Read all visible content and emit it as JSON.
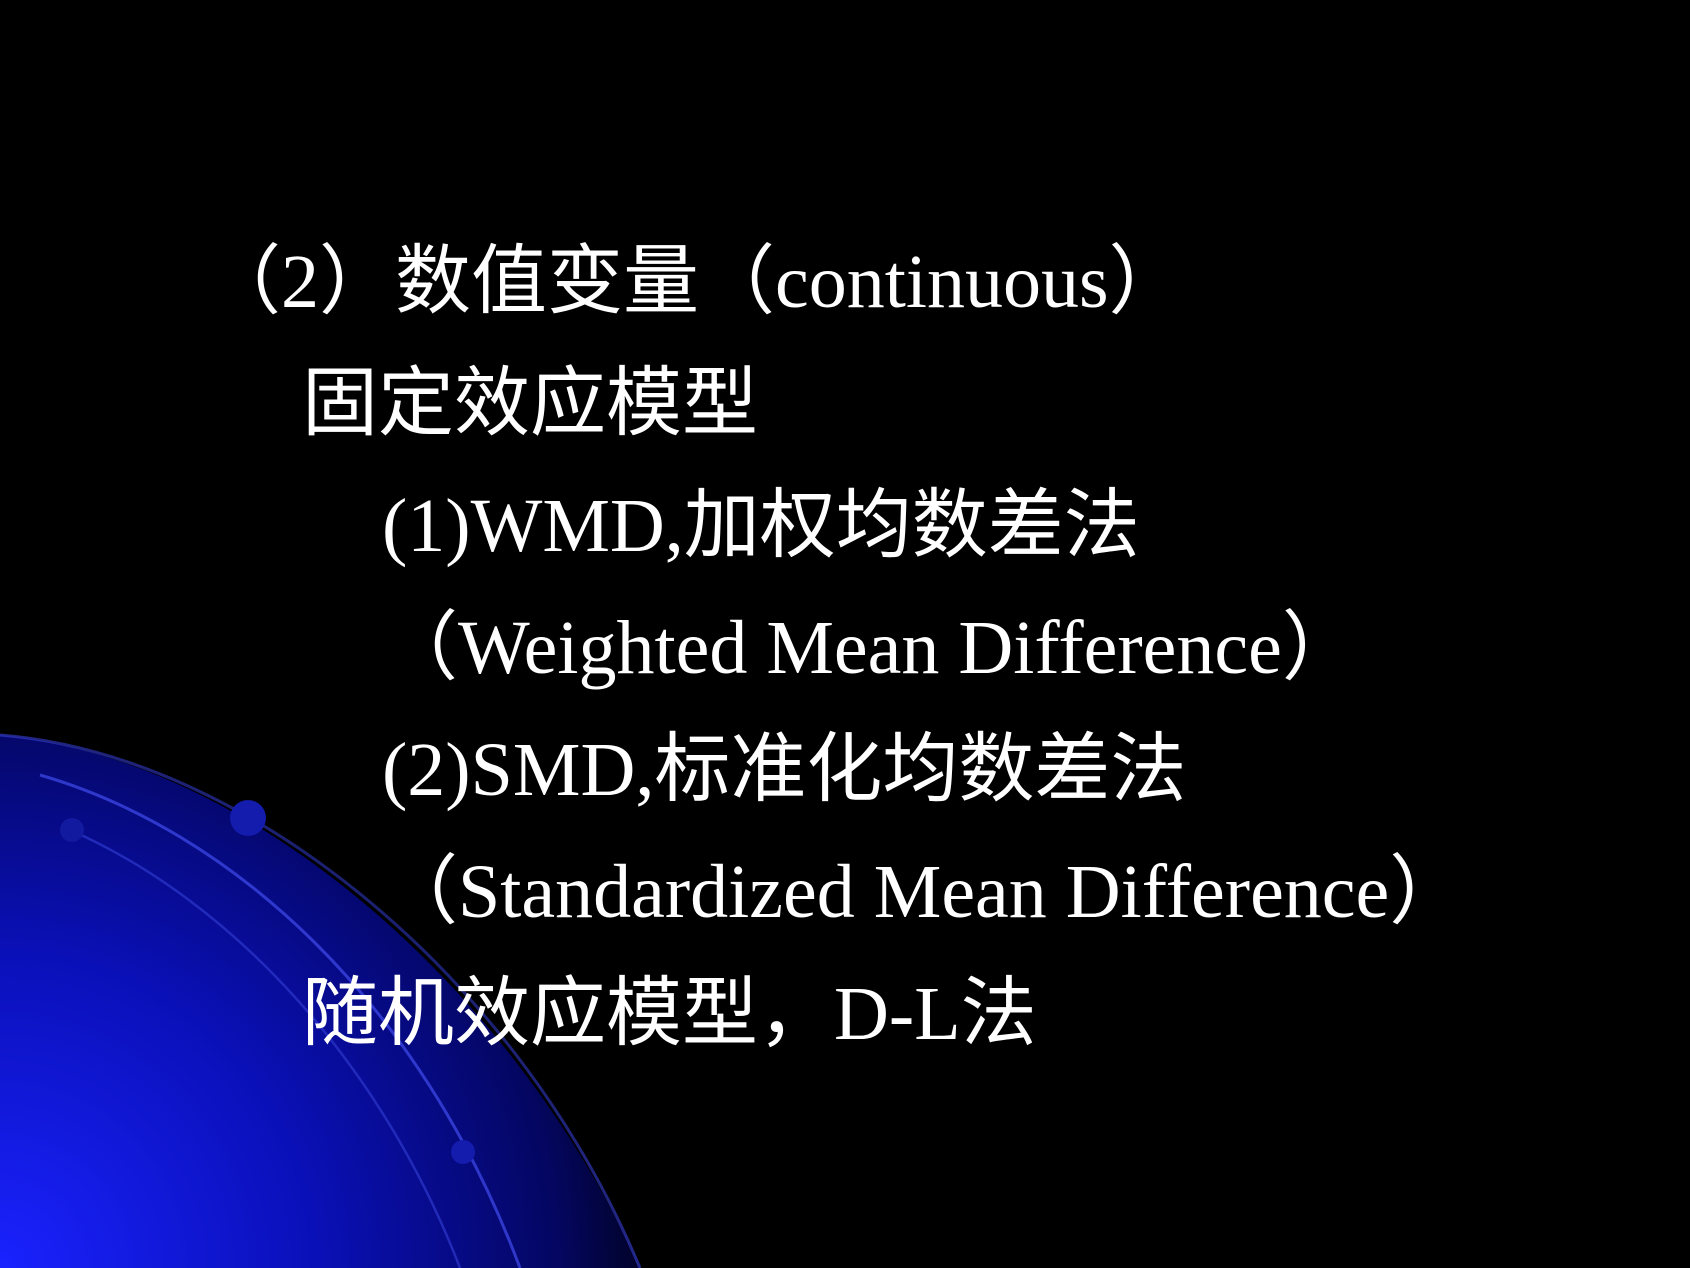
{
  "slide": {
    "lines": [
      "（2）数值变量（continuous）",
      "固定效应模型",
      "(1)WMD,加权均数差法",
      "（Weighted Mean Difference）",
      "(2)SMD,标准化均数差法",
      "（Standardized Mean Difference）",
      "随机效应模型，D-L法"
    ]
  },
  "colors": {
    "background": "#000000",
    "text": "#ffffff",
    "accent_blue": "#0a0fbf"
  }
}
